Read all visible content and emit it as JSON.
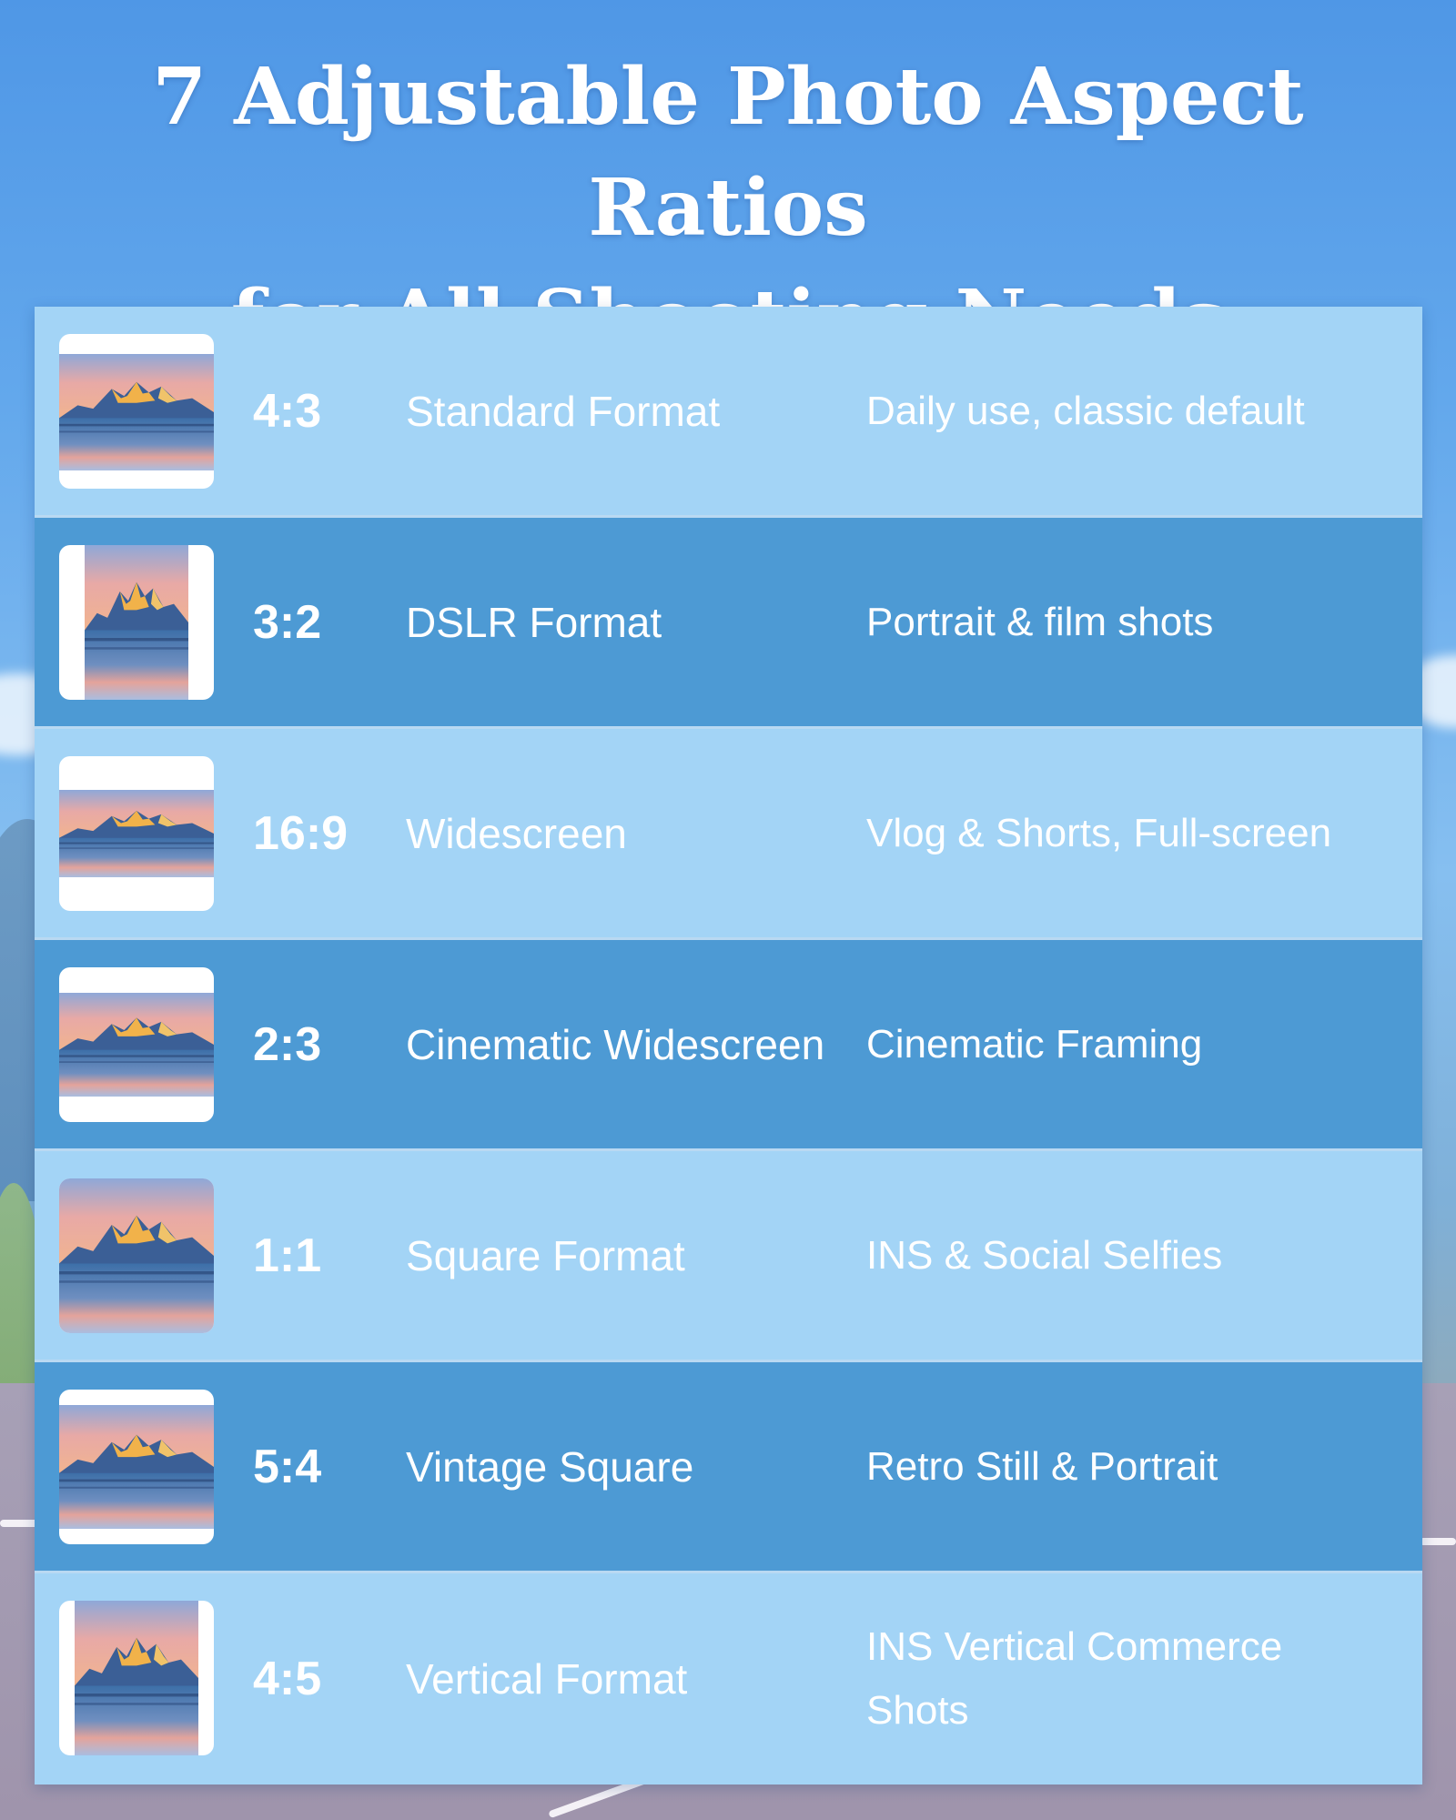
{
  "title": {
    "line1": "7 Adjustable Photo Aspect Ratios",
    "line2": "for All Shooting Needs"
  },
  "rows": [
    {
      "ratio": "4:3",
      "name": "Standard Format",
      "desc": "Daily use, classic default",
      "shade": "light",
      "photo": "landscape-4-3-icon"
    },
    {
      "ratio": "3:2",
      "name": "DSLR Format",
      "desc": "Portrait & film shots",
      "shade": "dark",
      "photo": "portrait-2-3-icon"
    },
    {
      "ratio": "16:9",
      "name": "Widescreen",
      "desc": "Vlog & Shorts, Full-screen",
      "shade": "light",
      "photo": "landscape-16-9-icon"
    },
    {
      "ratio": "2:3",
      "name": "Cinematic Widescreen",
      "desc": "Cinematic Framing",
      "shade": "dark",
      "photo": "landscape-3-2-icon"
    },
    {
      "ratio": "1:1",
      "name": "Square Format",
      "desc": "INS & Social Selfies",
      "shade": "light",
      "photo": "square-1-1-icon"
    },
    {
      "ratio": "5:4",
      "name": "Vintage Square",
      "desc": "Retro Still & Portrait",
      "shade": "dark",
      "photo": "landscape-5-4-icon"
    },
    {
      "ratio": "4:5",
      "name": "Vertical Format",
      "desc": "INS Vertical Commerce Shots",
      "shade": "light",
      "photo": "portrait-4-5-icon"
    }
  ],
  "colors": {
    "row_light": "#a3d4f6",
    "row_dark": "#4d9ad4",
    "text": "#ffffff"
  }
}
